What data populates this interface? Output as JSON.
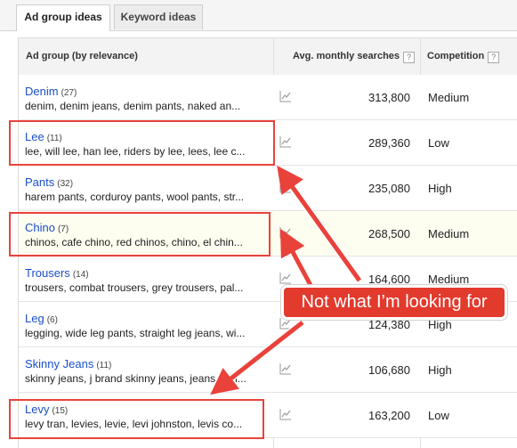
{
  "tabs": {
    "ad_group_ideas": "Ad group ideas",
    "keyword_ideas": "Keyword ideas"
  },
  "table": {
    "headers": {
      "ad_group": "Ad group (by relevance)",
      "avg_monthly": "Avg. monthly searches",
      "competition": "Competition",
      "help": "?"
    },
    "rows": [
      {
        "name": "Denim",
        "count": "(27)",
        "keywords": "denim, denim jeans, denim pants, naked an...",
        "volume": "313,800",
        "competition": "Medium"
      },
      {
        "name": "Lee",
        "count": "(11)",
        "keywords": "lee, will lee, han lee, riders by lee, lees, lee c...",
        "volume": "289,360",
        "competition": "Low"
      },
      {
        "name": "Pants",
        "count": "(32)",
        "keywords": "harem pants, corduroy pants, wool pants, str...",
        "volume": "235,080",
        "competition": "High"
      },
      {
        "name": "Chino",
        "count": "(7)",
        "keywords": "chinos, cafe chino, red chinos, chino, el chin...",
        "volume": "268,500",
        "competition": "Medium"
      },
      {
        "name": "Trousers",
        "count": "(14)",
        "keywords": "trousers, combat trousers, grey trousers, pal...",
        "volume": "164,600",
        "competition": "Medium"
      },
      {
        "name": "Leg",
        "count": "(6)",
        "keywords": "legging, wide leg pants, straight leg jeans, wi...",
        "volume": "124,380",
        "competition": "High"
      },
      {
        "name": "Skinny Jeans",
        "count": "(11)",
        "keywords": "skinny jeans, j brand skinny jeans, jeans skin...",
        "volume": "106,680",
        "competition": "High"
      },
      {
        "name": "Levy",
        "count": "(15)",
        "keywords": "levy tran, levies, levie, levi johnston, levis co...",
        "volume": "163,200",
        "competition": "Low"
      }
    ]
  },
  "annotation": {
    "callout": "Not what I’m looking for",
    "color": "#e23a2d"
  },
  "icons": {
    "trend": "trend-chart-icon"
  }
}
